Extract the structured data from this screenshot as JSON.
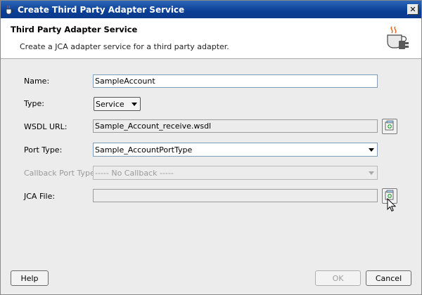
{
  "window": {
    "title": "Create Third Party Adapter Service",
    "close_glyph": "✕"
  },
  "header": {
    "title": "Third Party Adapter Service",
    "description": "Create a JCA adapter service for a third party adapter.",
    "icon": "coffee-cup-adapter-icon"
  },
  "form": {
    "name": {
      "label": "Name:",
      "value": "SampleAccount"
    },
    "type": {
      "label": "Type:",
      "value": "Service"
    },
    "wsdl_url": {
      "label": "WSDL URL:",
      "value": "Sample_Account_receive.wsdl"
    },
    "port_type": {
      "label": "Port Type:",
      "value": "Sample_AccountPortType"
    },
    "callback_port_type": {
      "label": "Callback Port Type:",
      "value": "----- No Callback -----"
    },
    "jca_file": {
      "label": "JCA File:",
      "value": ""
    }
  },
  "footer": {
    "help_label": "Help",
    "ok_label": "OK",
    "cancel_label": "Cancel"
  },
  "colors": {
    "titlebar": "#0a3e95",
    "dialog_bg": "#ececec",
    "field_border": "#7f9db9"
  }
}
